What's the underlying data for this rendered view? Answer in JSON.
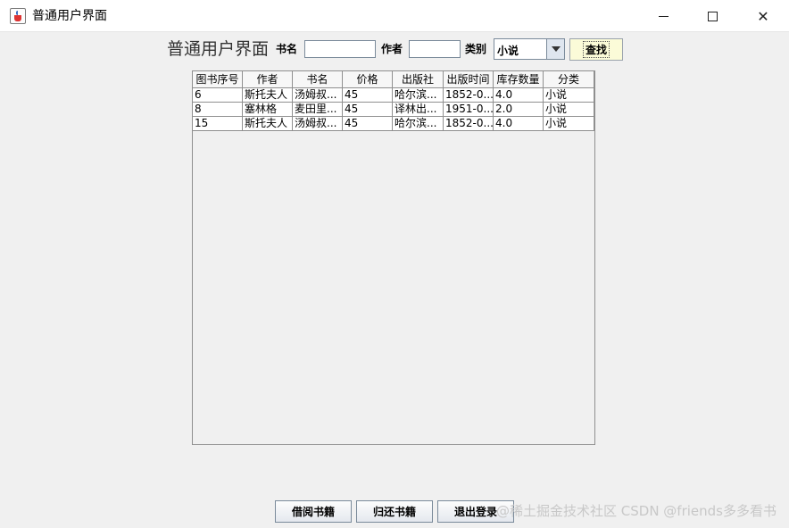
{
  "window": {
    "title": "普通用户界面"
  },
  "heading": "普通用户界面",
  "search": {
    "title_label": "书名",
    "title_value": "",
    "author_label": "作者",
    "author_value": "",
    "category_label": "类别",
    "category_value": "小说",
    "search_button": "查找"
  },
  "table": {
    "columns": [
      "图书序号",
      "作者",
      "书名",
      "价格",
      "出版社",
      "出版时间",
      "库存数量",
      "分类"
    ],
    "rows": [
      [
        "6",
        "斯托夫人",
        "汤姆叔...",
        "45",
        "哈尔滨...",
        "1852-0...",
        "4.0",
        "小说"
      ],
      [
        "8",
        "塞林格",
        "麦田里...",
        "45",
        "译林出...",
        "1951-0...",
        "2.0",
        "小说"
      ],
      [
        "15",
        "斯托夫人",
        "汤姆叔...",
        "45",
        "哈尔滨...",
        "1852-0...",
        "4.0",
        "小说"
      ]
    ]
  },
  "actions": {
    "borrow": "借阅书籍",
    "return": "归还书籍",
    "logout": "退出登录"
  },
  "watermark": "@稀土掘金技术社区 CSDN @friends多多看书"
}
